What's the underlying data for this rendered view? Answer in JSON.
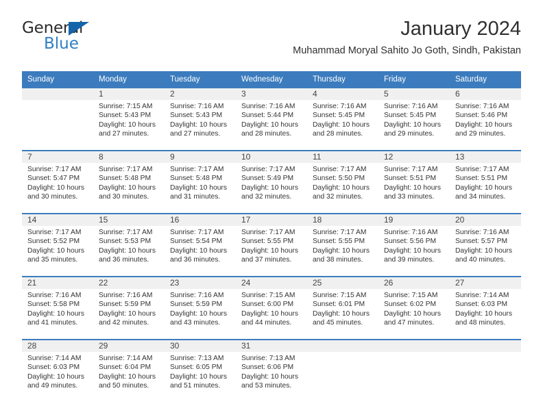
{
  "brand": {
    "word_one": "General",
    "word_two": "Blue",
    "triangle_color": "#1464aa",
    "blue_text_color": "#2e7fc4"
  },
  "header": {
    "title": "January 2024",
    "subtitle": "Muhammad Moryal Sahito Jo Goth, Sindh, Pakistan"
  },
  "theme": {
    "header_blue": "#3c7cbe",
    "band_gray": "#f0f0f0",
    "text": "#333333"
  },
  "weekdays": [
    "Sunday",
    "Monday",
    "Tuesday",
    "Wednesday",
    "Thursday",
    "Friday",
    "Saturday"
  ],
  "labels": {
    "sunrise_prefix": "Sunrise:",
    "sunset_prefix": "Sunset:",
    "daylight_prefix": "Daylight:"
  },
  "weeks": [
    [
      {
        "day": "",
        "empty": true
      },
      {
        "day": "1",
        "sunrise": "Sunrise: 7:15 AM",
        "sunset": "Sunset: 5:43 PM",
        "daylight_line1": "Daylight: 10 hours",
        "daylight_line2": "and 27 minutes."
      },
      {
        "day": "2",
        "sunrise": "Sunrise: 7:16 AM",
        "sunset": "Sunset: 5:43 PM",
        "daylight_line1": "Daylight: 10 hours",
        "daylight_line2": "and 27 minutes."
      },
      {
        "day": "3",
        "sunrise": "Sunrise: 7:16 AM",
        "sunset": "Sunset: 5:44 PM",
        "daylight_line1": "Daylight: 10 hours",
        "daylight_line2": "and 28 minutes."
      },
      {
        "day": "4",
        "sunrise": "Sunrise: 7:16 AM",
        "sunset": "Sunset: 5:45 PM",
        "daylight_line1": "Daylight: 10 hours",
        "daylight_line2": "and 28 minutes."
      },
      {
        "day": "5",
        "sunrise": "Sunrise: 7:16 AM",
        "sunset": "Sunset: 5:45 PM",
        "daylight_line1": "Daylight: 10 hours",
        "daylight_line2": "and 29 minutes."
      },
      {
        "day": "6",
        "sunrise": "Sunrise: 7:16 AM",
        "sunset": "Sunset: 5:46 PM",
        "daylight_line1": "Daylight: 10 hours",
        "daylight_line2": "and 29 minutes."
      }
    ],
    [
      {
        "day": "7",
        "sunrise": "Sunrise: 7:17 AM",
        "sunset": "Sunset: 5:47 PM",
        "daylight_line1": "Daylight: 10 hours",
        "daylight_line2": "and 30 minutes."
      },
      {
        "day": "8",
        "sunrise": "Sunrise: 7:17 AM",
        "sunset": "Sunset: 5:48 PM",
        "daylight_line1": "Daylight: 10 hours",
        "daylight_line2": "and 30 minutes."
      },
      {
        "day": "9",
        "sunrise": "Sunrise: 7:17 AM",
        "sunset": "Sunset: 5:48 PM",
        "daylight_line1": "Daylight: 10 hours",
        "daylight_line2": "and 31 minutes."
      },
      {
        "day": "10",
        "sunrise": "Sunrise: 7:17 AM",
        "sunset": "Sunset: 5:49 PM",
        "daylight_line1": "Daylight: 10 hours",
        "daylight_line2": "and 32 minutes."
      },
      {
        "day": "11",
        "sunrise": "Sunrise: 7:17 AM",
        "sunset": "Sunset: 5:50 PM",
        "daylight_line1": "Daylight: 10 hours",
        "daylight_line2": "and 32 minutes."
      },
      {
        "day": "12",
        "sunrise": "Sunrise: 7:17 AM",
        "sunset": "Sunset: 5:51 PM",
        "daylight_line1": "Daylight: 10 hours",
        "daylight_line2": "and 33 minutes."
      },
      {
        "day": "13",
        "sunrise": "Sunrise: 7:17 AM",
        "sunset": "Sunset: 5:51 PM",
        "daylight_line1": "Daylight: 10 hours",
        "daylight_line2": "and 34 minutes."
      }
    ],
    [
      {
        "day": "14",
        "sunrise": "Sunrise: 7:17 AM",
        "sunset": "Sunset: 5:52 PM",
        "daylight_line1": "Daylight: 10 hours",
        "daylight_line2": "and 35 minutes."
      },
      {
        "day": "15",
        "sunrise": "Sunrise: 7:17 AM",
        "sunset": "Sunset: 5:53 PM",
        "daylight_line1": "Daylight: 10 hours",
        "daylight_line2": "and 36 minutes."
      },
      {
        "day": "16",
        "sunrise": "Sunrise: 7:17 AM",
        "sunset": "Sunset: 5:54 PM",
        "daylight_line1": "Daylight: 10 hours",
        "daylight_line2": "and 36 minutes."
      },
      {
        "day": "17",
        "sunrise": "Sunrise: 7:17 AM",
        "sunset": "Sunset: 5:55 PM",
        "daylight_line1": "Daylight: 10 hours",
        "daylight_line2": "and 37 minutes."
      },
      {
        "day": "18",
        "sunrise": "Sunrise: 7:17 AM",
        "sunset": "Sunset: 5:55 PM",
        "daylight_line1": "Daylight: 10 hours",
        "daylight_line2": "and 38 minutes."
      },
      {
        "day": "19",
        "sunrise": "Sunrise: 7:16 AM",
        "sunset": "Sunset: 5:56 PM",
        "daylight_line1": "Daylight: 10 hours",
        "daylight_line2": "and 39 minutes."
      },
      {
        "day": "20",
        "sunrise": "Sunrise: 7:16 AM",
        "sunset": "Sunset: 5:57 PM",
        "daylight_line1": "Daylight: 10 hours",
        "daylight_line2": "and 40 minutes."
      }
    ],
    [
      {
        "day": "21",
        "sunrise": "Sunrise: 7:16 AM",
        "sunset": "Sunset: 5:58 PM",
        "daylight_line1": "Daylight: 10 hours",
        "daylight_line2": "and 41 minutes."
      },
      {
        "day": "22",
        "sunrise": "Sunrise: 7:16 AM",
        "sunset": "Sunset: 5:59 PM",
        "daylight_line1": "Daylight: 10 hours",
        "daylight_line2": "and 42 minutes."
      },
      {
        "day": "23",
        "sunrise": "Sunrise: 7:16 AM",
        "sunset": "Sunset: 5:59 PM",
        "daylight_line1": "Daylight: 10 hours",
        "daylight_line2": "and 43 minutes."
      },
      {
        "day": "24",
        "sunrise": "Sunrise: 7:15 AM",
        "sunset": "Sunset: 6:00 PM",
        "daylight_line1": "Daylight: 10 hours",
        "daylight_line2": "and 44 minutes."
      },
      {
        "day": "25",
        "sunrise": "Sunrise: 7:15 AM",
        "sunset": "Sunset: 6:01 PM",
        "daylight_line1": "Daylight: 10 hours",
        "daylight_line2": "and 45 minutes."
      },
      {
        "day": "26",
        "sunrise": "Sunrise: 7:15 AM",
        "sunset": "Sunset: 6:02 PM",
        "daylight_line1": "Daylight: 10 hours",
        "daylight_line2": "and 47 minutes."
      },
      {
        "day": "27",
        "sunrise": "Sunrise: 7:14 AM",
        "sunset": "Sunset: 6:03 PM",
        "daylight_line1": "Daylight: 10 hours",
        "daylight_line2": "and 48 minutes."
      }
    ],
    [
      {
        "day": "28",
        "sunrise": "Sunrise: 7:14 AM",
        "sunset": "Sunset: 6:03 PM",
        "daylight_line1": "Daylight: 10 hours",
        "daylight_line2": "and 49 minutes."
      },
      {
        "day": "29",
        "sunrise": "Sunrise: 7:14 AM",
        "sunset": "Sunset: 6:04 PM",
        "daylight_line1": "Daylight: 10 hours",
        "daylight_line2": "and 50 minutes."
      },
      {
        "day": "30",
        "sunrise": "Sunrise: 7:13 AM",
        "sunset": "Sunset: 6:05 PM",
        "daylight_line1": "Daylight: 10 hours",
        "daylight_line2": "and 51 minutes."
      },
      {
        "day": "31",
        "sunrise": "Sunrise: 7:13 AM",
        "sunset": "Sunset: 6:06 PM",
        "daylight_line1": "Daylight: 10 hours",
        "daylight_line2": "and 53 minutes."
      },
      {
        "day": "",
        "empty": true
      },
      {
        "day": "",
        "empty": true
      },
      {
        "day": "",
        "empty": true
      }
    ]
  ]
}
